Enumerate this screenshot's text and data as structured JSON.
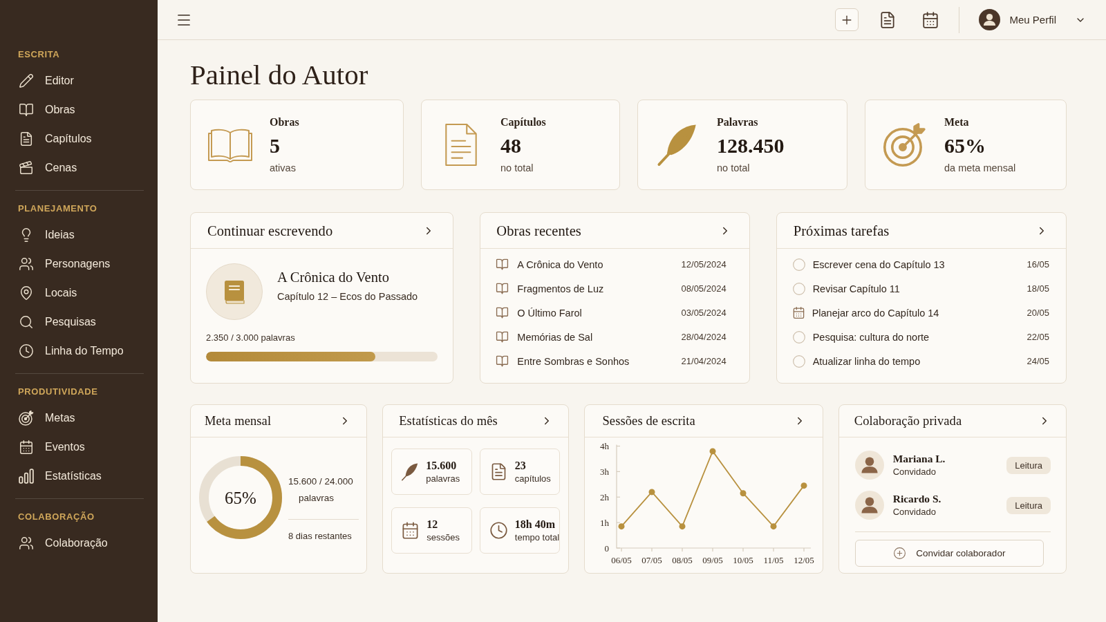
{
  "sidebar": {
    "sections": [
      {
        "label": "ESCRITA",
        "items": [
          {
            "label": "Editor",
            "kind": "editor",
            "selected": false
          },
          {
            "label": "Obras",
            "kind": "works",
            "selected": false
          },
          {
            "label": "Capítulos",
            "kind": "chapters",
            "selected": false
          },
          {
            "label": "Cenas",
            "kind": "scenes",
            "selected": false
          }
        ]
      },
      {
        "label": "PLANEJAMENTO",
        "items": [
          {
            "label": "Ideias",
            "kind": "ideas",
            "selected": false
          },
          {
            "label": "Personagens",
            "kind": "characters",
            "selected": false
          },
          {
            "label": "Locais",
            "kind": "places",
            "selected": false
          },
          {
            "label": "Pesquisas",
            "kind": "research",
            "selected": false
          },
          {
            "label": "Linha do Tempo",
            "kind": "timeline",
            "selected": false
          }
        ]
      },
      {
        "label": "PRODUTIVIDADE",
        "items": [
          {
            "label": "Metas",
            "kind": "goals",
            "selected": false
          },
          {
            "label": "Eventos",
            "kind": "events",
            "selected": false
          },
          {
            "label": "Estatísticas",
            "kind": "stats",
            "selected": false
          }
        ]
      },
      {
        "label": "COLABORAÇÃO",
        "items": [
          {
            "label": "Colaboração",
            "kind": "collab",
            "selected": false
          }
        ]
      }
    ]
  },
  "topbar": {
    "actions": [
      {
        "kind": "add"
      },
      {
        "kind": "document"
      },
      {
        "kind": "calendar"
      }
    ],
    "profile": {
      "name": "Meu Perfil"
    }
  },
  "page_title": "Painel do Autor",
  "stats": [
    {
      "kind": "works",
      "label": "Obras",
      "value": "5",
      "caption": "ativas"
    },
    {
      "kind": "chapters",
      "label": "Capítulos",
      "value": "48",
      "caption": "no total"
    },
    {
      "kind": "words",
      "label": "Palavras",
      "value": "128.450",
      "caption": "no total"
    },
    {
      "kind": "goal",
      "label": "Meta",
      "value": "65%",
      "caption": "da meta mensal"
    }
  ],
  "continue": {
    "title": "Continuar escrevendo",
    "work": "A Crônica do Vento",
    "chapter": "Capítulo 12 – Ecos do Passado",
    "progress": {
      "text": "2.350 / 3.000 palavras",
      "level": 0.73
    }
  },
  "recent_works": {
    "title": "Obras recentes",
    "rows": [
      {
        "title": "A Crônica do Vento",
        "date": "12/05/2024"
      },
      {
        "title": "Fragmentos de Luz",
        "date": "08/05/2024"
      },
      {
        "title": "O Último Farol",
        "date": "03/05/2024"
      },
      {
        "title": "Memórias de Sal",
        "date": "28/04/2024"
      },
      {
        "title": "Entre Sombras e Sonhos",
        "date": "21/04/2024"
      }
    ]
  },
  "tasks": {
    "title": "Próximas tarefas",
    "items": [
      {
        "kind": "task",
        "text": "Escrever cena do Capítulo 13",
        "date": "16/05",
        "checked": false
      },
      {
        "kind": "task",
        "text": "Revisar Capítulo 11",
        "date": "18/05",
        "checked": false
      },
      {
        "kind": "event",
        "text": "Planejar arco do Capítulo 14",
        "date": "20/05",
        "checked": false
      },
      {
        "kind": "task",
        "text": "Pesquisa: cultura do norte",
        "date": "22/05",
        "checked": false
      },
      {
        "kind": "task",
        "text": "Atualizar linha do tempo",
        "date": "24/05",
        "checked": false
      }
    ]
  },
  "monthly_goal": {
    "title": "Meta mensal",
    "level": 0.65,
    "percent": "65%",
    "words": "15.600 / 24.000",
    "unit": "palavras",
    "remaining": "8 dias restantes"
  },
  "month_stats": {
    "title": "Estatísticas do mês",
    "tiles": [
      {
        "kind": "words",
        "value": "15.600",
        "label": "palavras"
      },
      {
        "kind": "chapters",
        "value": "23",
        "label": "capítulos"
      },
      {
        "kind": "sessions",
        "value": "12",
        "label": "sessões"
      },
      {
        "kind": "time",
        "value": "18h 40m",
        "label": "tempo total"
      }
    ]
  },
  "sessions": {
    "title": "Sessões de escrita",
    "chart_data": {
      "type": "line",
      "categories": [
        "06/05",
        "07/05",
        "08/05",
        "09/05",
        "10/05",
        "11/05",
        "12/05"
      ],
      "ylim": [
        0,
        4
      ],
      "yticks": [
        {
          "value": 0,
          "label": "0"
        },
        {
          "value": 1,
          "label": "1h"
        },
        {
          "value": 2,
          "label": "2h"
        },
        {
          "value": 3,
          "label": "3h"
        },
        {
          "value": 4,
          "label": "4h"
        }
      ],
      "series": [
        {
          "color": "#b8913f",
          "marker": true,
          "values": [
            0.85,
            2.2,
            0.85,
            3.8,
            2.15,
            0.85,
            2.45
          ]
        }
      ]
    }
  },
  "collaboration": {
    "title": "Colaboração privada",
    "members": [
      {
        "name": "Mariana L.",
        "role": "Convidado",
        "access": "Leitura"
      },
      {
        "name": "Ricardo S.",
        "role": "Convidado",
        "access": "Leitura"
      }
    ],
    "invite": "Convidar colaborador"
  }
}
